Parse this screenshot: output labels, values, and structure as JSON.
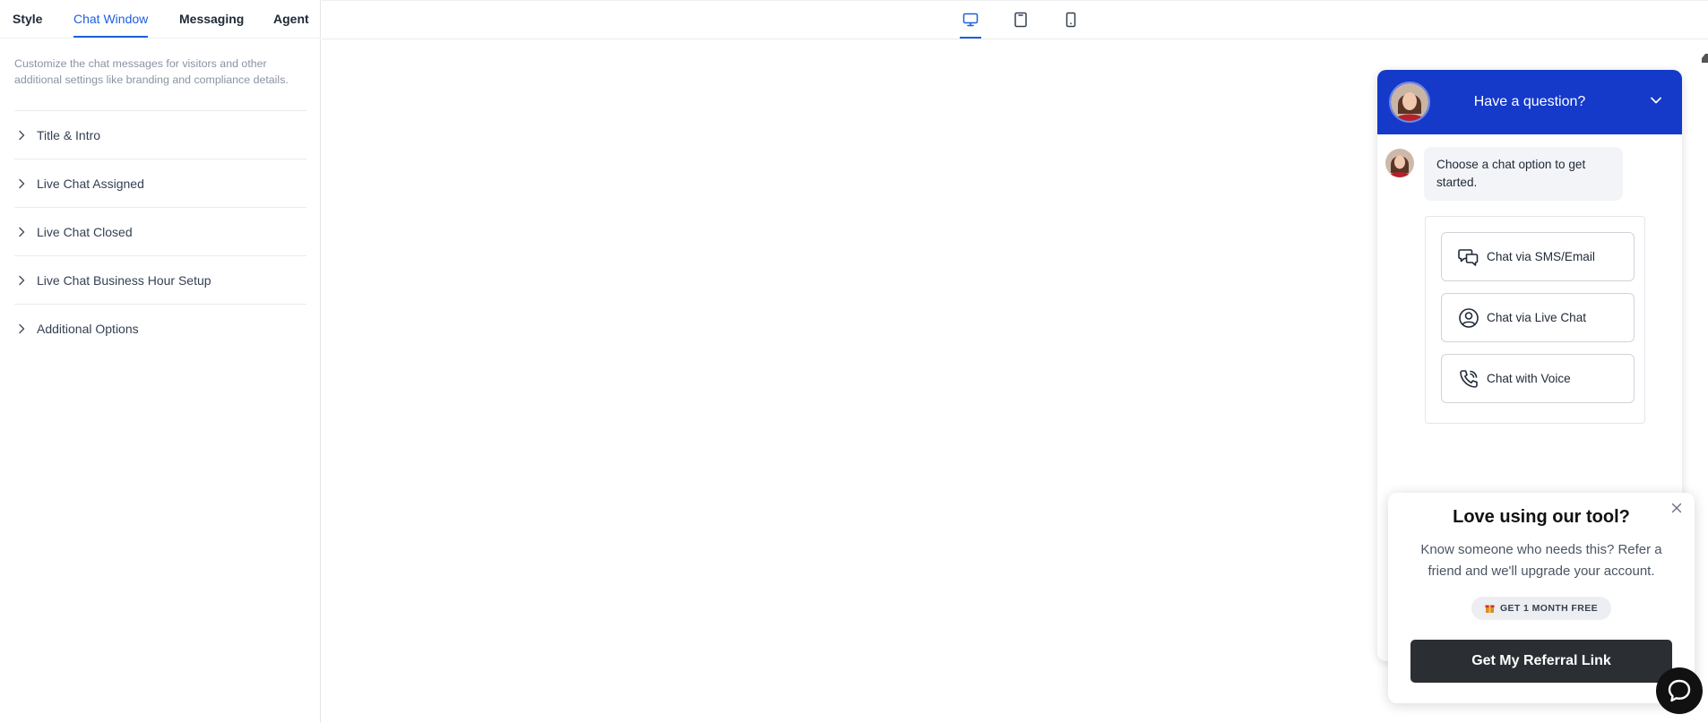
{
  "sidebar": {
    "tabs": [
      {
        "label": "Style"
      },
      {
        "label": "Chat Window"
      },
      {
        "label": "Messaging"
      },
      {
        "label": "Agent"
      }
    ],
    "active_tab": "Chat Window",
    "description": "Customize the chat messages for visitors and other additional settings like branding and compliance details.",
    "sections": [
      {
        "label": "Title & Intro"
      },
      {
        "label": "Live Chat Assigned"
      },
      {
        "label": "Live Chat Closed"
      },
      {
        "label": "Live Chat Business Hour Setup"
      },
      {
        "label": "Additional Options"
      }
    ]
  },
  "preview": {
    "devices": [
      "desktop-icon",
      "tablet-icon",
      "mobile-icon"
    ],
    "active_device": "desktop"
  },
  "chat": {
    "title": "Have a question?",
    "intro_message": "Choose a chat option to get started.",
    "options": [
      {
        "label": "Chat via SMS/Email",
        "icon": "chat-bubbles-icon"
      },
      {
        "label": "Chat via Live Chat",
        "icon": "user-circle-icon"
      },
      {
        "label": "Chat with Voice",
        "icon": "phone-icon"
      }
    ],
    "header_color": "#1539c9"
  },
  "promo": {
    "title": "Love using our tool?",
    "body": "Know someone who needs this? Refer a friend and we'll upgrade your account.",
    "badge": "GET 1 MONTH FREE",
    "cta": "Get My Referral Link"
  },
  "colors": {
    "accent": "#1d5fe0",
    "cta_bg": "#2b2e33"
  }
}
